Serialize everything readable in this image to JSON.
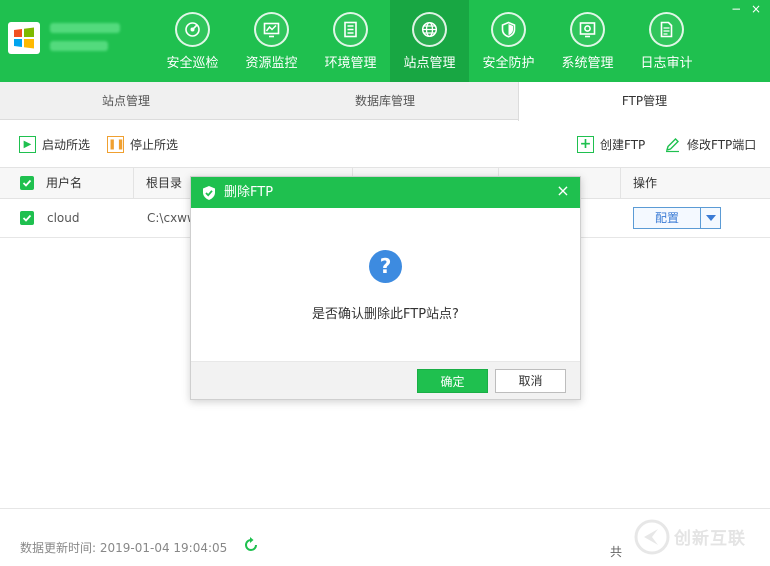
{
  "header": {
    "nav": [
      {
        "label": "安全巡检",
        "icon": "radar-scan-icon"
      },
      {
        "label": "资源监控",
        "icon": "monitor-chart-icon"
      },
      {
        "label": "环境管理",
        "icon": "server-building-icon"
      },
      {
        "label": "站点管理",
        "icon": "globe-icon",
        "active": true
      },
      {
        "label": "安全防护",
        "icon": "shield-icon"
      },
      {
        "label": "系统管理",
        "icon": "gear-icon"
      },
      {
        "label": "日志审计",
        "icon": "document-icon"
      }
    ],
    "window_buttons": [
      "−",
      "×"
    ]
  },
  "subtabs": [
    {
      "label": "站点管理"
    },
    {
      "label": "数据库管理"
    },
    {
      "label": "FTP管理",
      "active": true
    }
  ],
  "toolbar": {
    "start_selected": "启动所选",
    "stop_selected": "停止所选",
    "create_ftp": "创建FTP",
    "modify_ftp_port": "修改FTP端口"
  },
  "table": {
    "headers": {
      "username": "用户名",
      "root_dir": "根目录",
      "col3": "",
      "col4": "",
      "col5": "",
      "action": "操作"
    },
    "rows": [
      {
        "username": "cloud",
        "root_dir": "C:\\cxww",
        "action_label": "配置"
      }
    ]
  },
  "dialog": {
    "title": "删除FTP",
    "question_mark": "?",
    "message": "是否确认删除此FTP站点?",
    "ok": "确定",
    "cancel": "取消",
    "close": "×"
  },
  "footer": {
    "update_time": "数据更新时间: 2019-01-04 19:04:05",
    "total_prefix": "共"
  },
  "watermark": {
    "text": "创新互联"
  },
  "colors": {
    "brand_green": "#1fc04f",
    "active_nav": "#18a743",
    "question_blue": "#3d8be0",
    "config_blue": "#3a7bd5"
  }
}
